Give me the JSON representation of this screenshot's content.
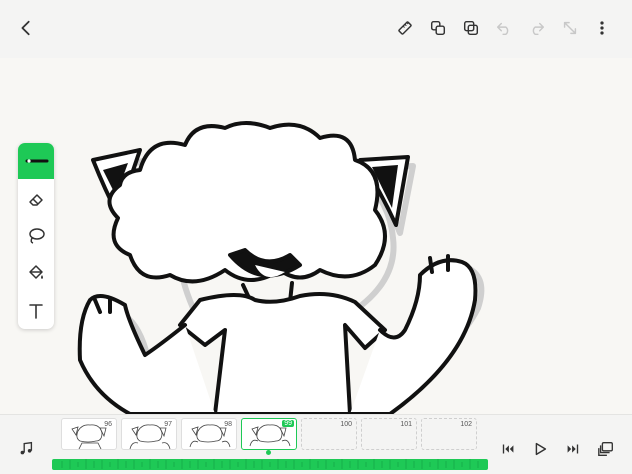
{
  "header": {
    "icons": [
      "back-icon",
      "ruler-icon",
      "duplicate-frame-icon",
      "copy-icon",
      "undo-icon",
      "redo-icon",
      "resize-icon",
      "more-icon"
    ]
  },
  "toolbox": {
    "tools": [
      "pen-icon",
      "eraser-icon",
      "lasso-icon",
      "fill-bucket-icon",
      "text-icon"
    ],
    "active": "pen-icon"
  },
  "timeline": {
    "frames": [
      {
        "number": "96",
        "filled": true
      },
      {
        "number": "97",
        "filled": true
      },
      {
        "number": "98",
        "filled": true
      },
      {
        "number": "99",
        "filled": true,
        "selected": true
      },
      {
        "number": "100",
        "filled": false
      },
      {
        "number": "101",
        "filled": false
      },
      {
        "number": "102",
        "filled": false
      }
    ]
  },
  "controls": [
    "music-icon",
    "skip-back-icon",
    "play-icon",
    "skip-forward-icon",
    "layers-icon"
  ],
  "colors": {
    "accent": "#1ec956",
    "stroke": "#111111",
    "shadow": "#cfcfcf"
  }
}
